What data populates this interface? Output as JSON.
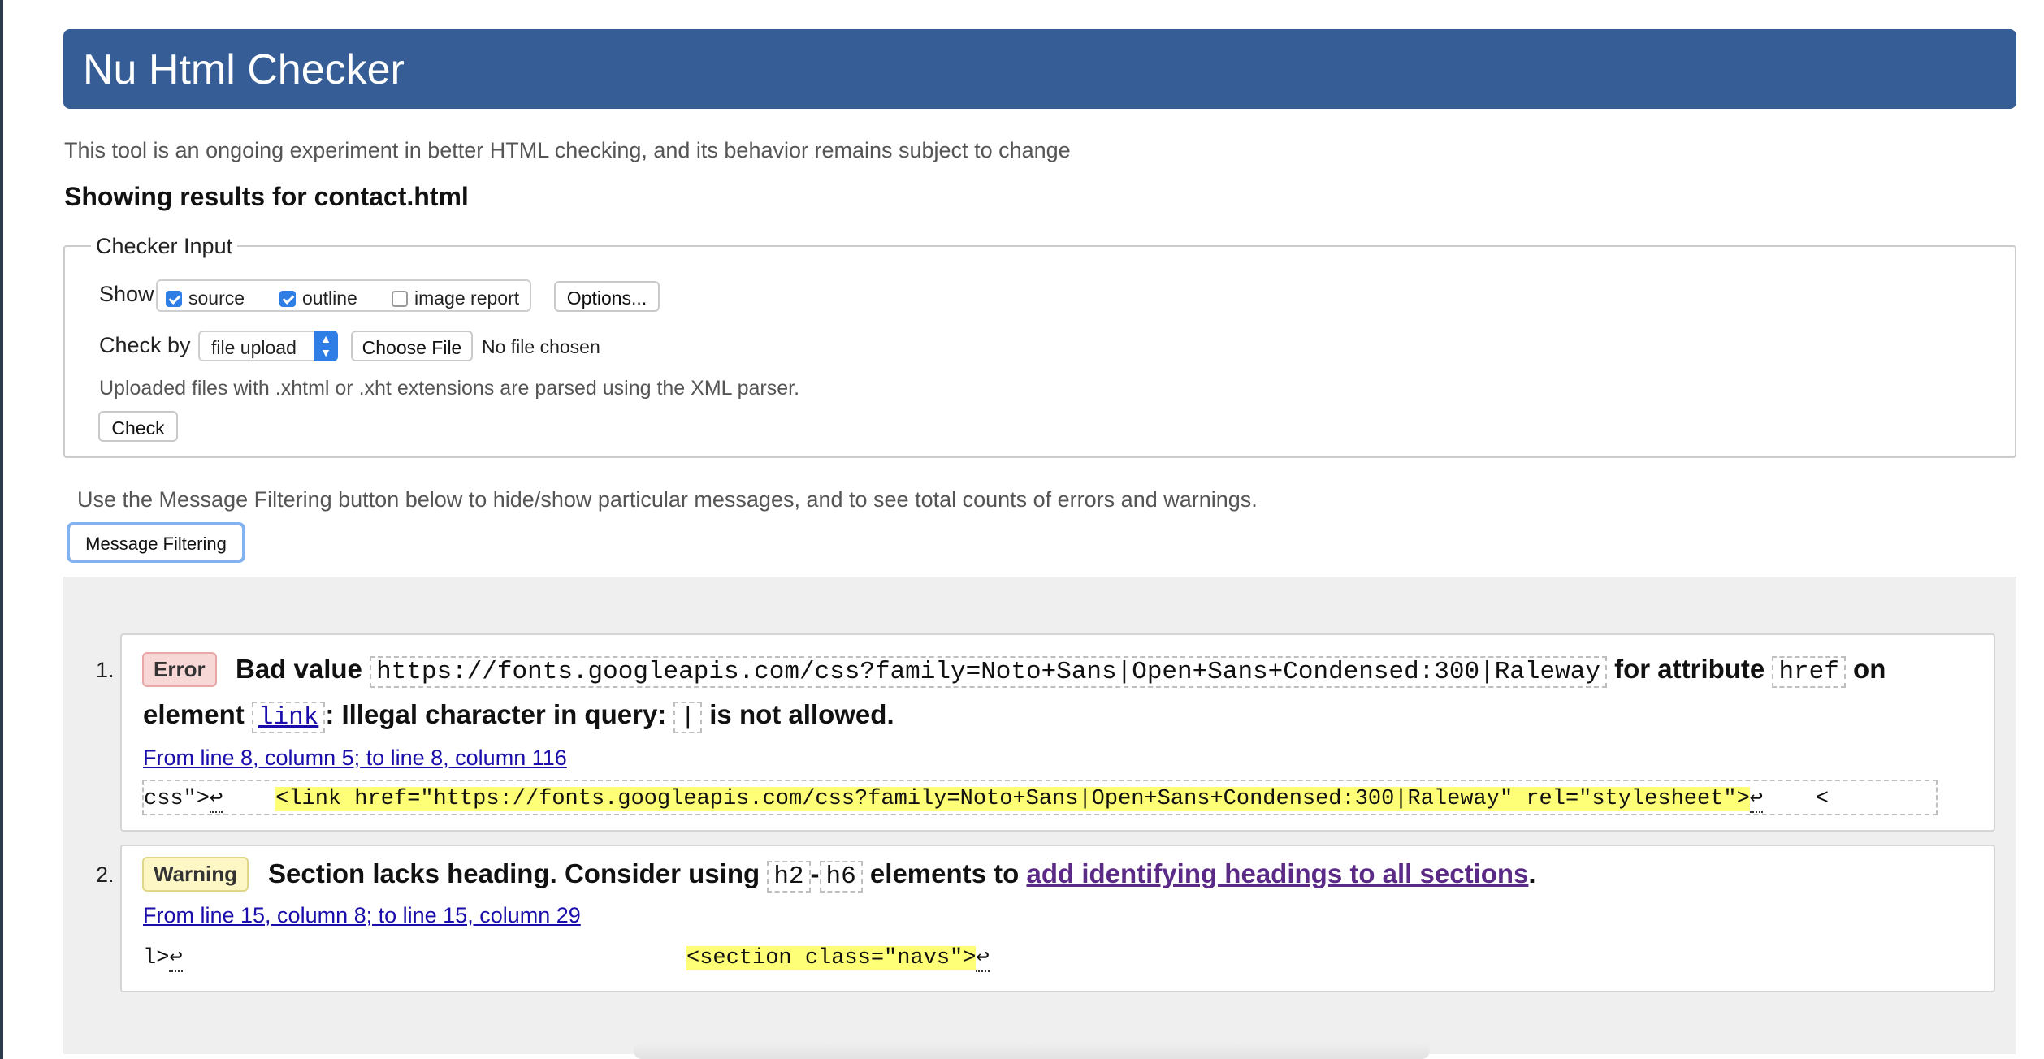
{
  "header": {
    "title": "Nu Html Checker"
  },
  "intro": "This tool is an ongoing experiment in better HTML checking, and its behavior remains subject to change",
  "showing_results": "Showing results for contact.html",
  "checker_input": {
    "legend": "Checker Input",
    "show_label": "Show",
    "options": [
      {
        "label": "source",
        "checked": true
      },
      {
        "label": "outline",
        "checked": true
      },
      {
        "label": "image report",
        "checked": false
      }
    ],
    "options_button": "Options...",
    "check_by_label": "Check by",
    "check_by_value": "file upload",
    "choose_file_button": "Choose File",
    "no_file": "No file chosen",
    "hint": "Uploaded files with .xhtml or .xht extensions are parsed using the XML parser.",
    "check_button": "Check"
  },
  "filter_note": "Use the Message Filtering button below to hide/show particular messages, and to see total counts of errors and warnings.",
  "message_filtering_button": "Message Filtering",
  "messages": [
    {
      "number": "1.",
      "type": "Error",
      "text_bad_value": "Bad value",
      "value": "https://fonts.googleapis.com/css?family=Noto+Sans|Open+Sans+Condensed:300|Raleway",
      "text_for_attribute": "for attribute",
      "attribute": "href",
      "text_on": "on",
      "text_element": "element",
      "element": "link",
      "text_illegal": ": Illegal character in query:",
      "char": "|",
      "text_not_allowed": "is not allowed.",
      "location": "From line 8, column 5; to line 8, column 116",
      "extract_before": "css\">",
      "extract_return1": "↩",
      "extract_gap": "    ",
      "extract_highlight": "<link href=\"https://fonts.googleapis.com/css?family=Noto+Sans|Open+Sans+Condensed:300|Raleway\" rel=\"stylesheet\">",
      "extract_return2": "↩",
      "extract_after": "    <"
    },
    {
      "number": "2.",
      "type": "Warning",
      "text_lacks": "Section lacks heading. Consider using",
      "h2": "h2",
      "dash": "-",
      "h6": "h6",
      "text_elements_to": "elements to",
      "link_text": "add identifying headings to all sections",
      "period": ".",
      "location": "From line 15, column 8; to line 15, column 29",
      "extract_before": "l>",
      "extract_return1": "↩",
      "extract_highlight": "<section class=\"navs\">",
      "extract_return2": "↩"
    }
  ]
}
